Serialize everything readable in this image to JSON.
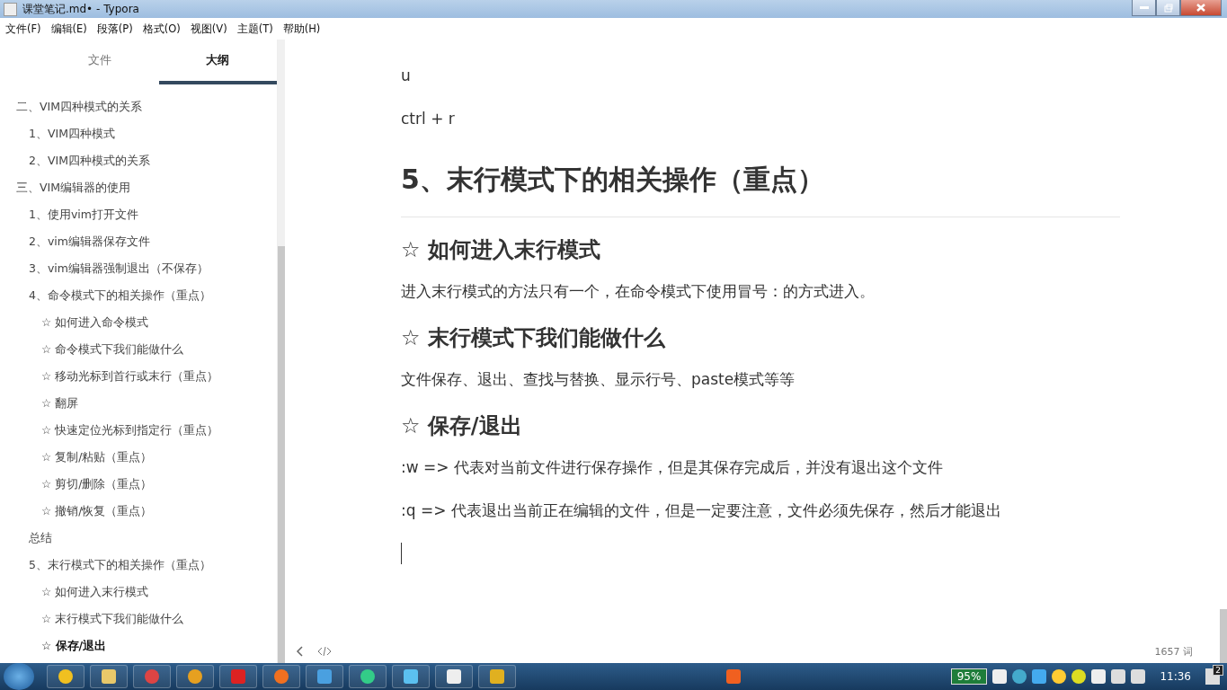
{
  "window": {
    "title": "课堂笔记.md• - Typora"
  },
  "menu": [
    "文件(F)",
    "编辑(E)",
    "段落(P)",
    "格式(O)",
    "视图(V)",
    "主题(T)",
    "帮助(H)"
  ],
  "sidebar_tabs": [
    {
      "label": "文件",
      "selected": false
    },
    {
      "label": "大纲",
      "selected": true
    }
  ],
  "outline": [
    {
      "label": "二、VIM四种模式的关系",
      "selected": false,
      "children": [
        {
          "label": "1、VIM四种模式",
          "selected": false
        },
        {
          "label": "2、VIM四种模式的关系",
          "selected": false
        }
      ]
    },
    {
      "label": "三、VIM编辑器的使用",
      "selected": false,
      "children": [
        {
          "label": "1、使用vim打开文件",
          "selected": false
        },
        {
          "label": "2、vim编辑器保存文件",
          "selected": false
        },
        {
          "label": "3、vim编辑器强制退出（不保存）",
          "selected": false
        },
        {
          "label": "4、命令模式下的相关操作（重点）",
          "selected": false,
          "children": [
            {
              "label": "☆ 如何进入命令模式",
              "selected": false
            },
            {
              "label": "☆ 命令模式下我们能做什么",
              "selected": false
            },
            {
              "label": "☆ 移动光标到首行或末行（重点）",
              "selected": false
            },
            {
              "label": "☆ 翻屏",
              "selected": false
            },
            {
              "label": "☆ 快速定位光标到指定行（重点）",
              "selected": false
            },
            {
              "label": "☆ 复制/粘贴（重点）",
              "selected": false
            },
            {
              "label": "☆ 剪切/删除（重点）",
              "selected": false
            },
            {
              "label": "☆ 撤销/恢复（重点）",
              "selected": false
            }
          ]
        },
        {
          "label": "总结",
          "selected": false
        },
        {
          "label": "5、末行模式下的相关操作（重点）",
          "selected": false,
          "children": [
            {
              "label": "☆ 如何进入末行模式",
              "selected": false
            },
            {
              "label": "☆ 末行模式下我们能做什么",
              "selected": false
            },
            {
              "label": "☆ 保存/退出",
              "selected": true
            }
          ]
        }
      ]
    }
  ],
  "document": [
    {
      "kind": "paragraph",
      "text": "u"
    },
    {
      "kind": "paragraph",
      "text": "ctrl + r"
    },
    {
      "kind": "heading2",
      "text": "5、末行模式下的相关操作（重点）"
    },
    {
      "kind": "heading3",
      "text": "☆ 如何进入末行模式"
    },
    {
      "kind": "paragraph",
      "text": "进入末行模式的方法只有一个，在命令模式下使用冒号：的方式进入。"
    },
    {
      "kind": "heading3",
      "text": "☆ 末行模式下我们能做什么"
    },
    {
      "kind": "paragraph",
      "text": "文件保存、退出、查找与替换、显示行号、paste模式等等"
    },
    {
      "kind": "heading3",
      "text": "☆ 保存/退出"
    },
    {
      "kind": "paragraph",
      "text": ":w => 代表对当前文件进行保存操作，但是其保存完成后，并没有退出这个文件"
    },
    {
      "kind": "paragraph",
      "text": ":q => 代表退出当前正在编辑的文件，但是一定要注意，文件必须先保存，然后才能退出"
    },
    {
      "kind": "cursor"
    }
  ],
  "footer": {
    "word_count": "1657 词"
  },
  "taskbar": {
    "battery": "95%",
    "clock": "11:36",
    "notification_count": "2"
  }
}
